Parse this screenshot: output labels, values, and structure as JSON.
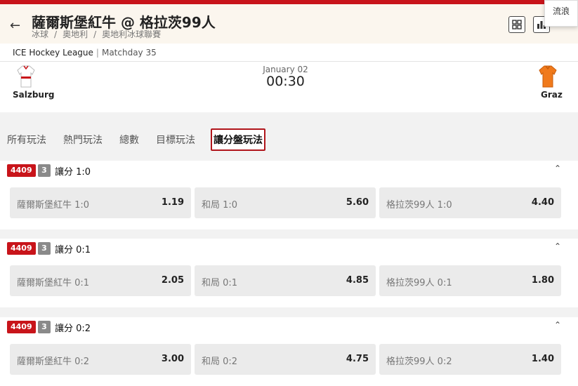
{
  "header": {
    "back_icon": "arrow-left-icon",
    "title": "薩爾斯堡紅牛 @ 格拉茨99人",
    "breadcrumbs": [
      "冰球",
      "奧地利",
      "奧地利冰球聯賽"
    ],
    "popup_label": "流浪",
    "icons": [
      "stats-grid-icon",
      "bar-chart-icon"
    ]
  },
  "league": {
    "name": "ICE Hockey League",
    "matchday": "Matchday 35"
  },
  "match": {
    "home": "Salzburg",
    "away": "Graz",
    "date": "January 02",
    "time": "00:30",
    "home_jersey_color": "#ffffff",
    "away_jersey_color": "#f07a1c"
  },
  "tabs": [
    "所有玩法",
    "熱門玩法",
    "總數",
    "目標玩法",
    "讓分盤玩法"
  ],
  "active_tab": "讓分盤玩法",
  "markets": [
    {
      "id": "4409",
      "count": "3",
      "title": "讓分 1:0",
      "odds": [
        {
          "label": "薩爾斯堡紅牛 1:0",
          "value": "1.19"
        },
        {
          "label": "和局 1:0",
          "value": "5.60"
        },
        {
          "label": "格拉茨99人 1:0",
          "value": "4.40"
        }
      ]
    },
    {
      "id": "4409",
      "count": "3",
      "title": "讓分 0:1",
      "odds": [
        {
          "label": "薩爾斯堡紅牛 0:1",
          "value": "2.05"
        },
        {
          "label": "和局 0:1",
          "value": "4.85"
        },
        {
          "label": "格拉茨99人 0:1",
          "value": "1.80"
        }
      ]
    },
    {
      "id": "4409",
      "count": "3",
      "title": "讓分 0:2",
      "odds": [
        {
          "label": "薩爾斯堡紅牛 0:2",
          "value": "3.00"
        },
        {
          "label": "和局 0:2",
          "value": "4.75"
        },
        {
          "label": "格拉茨99人 0:2",
          "value": "1.40"
        }
      ]
    }
  ],
  "colors": {
    "accent": "#c8141a",
    "count_badge": "#8a8a8a",
    "header_bg": "#fbf6ee"
  }
}
